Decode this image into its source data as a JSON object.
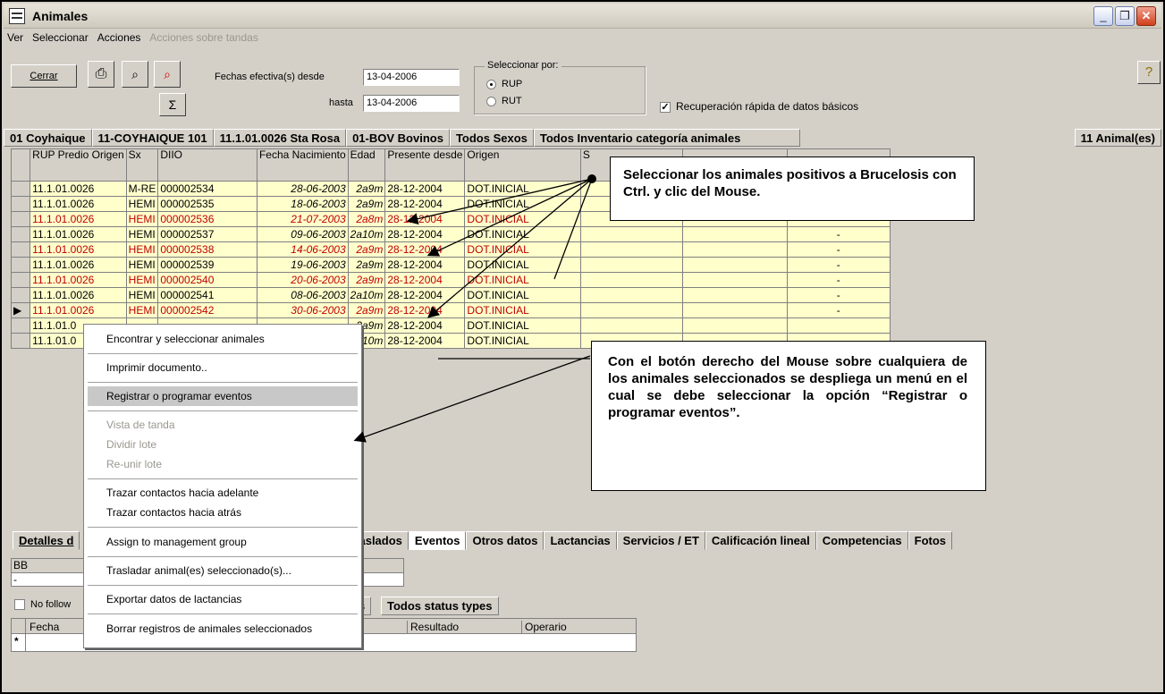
{
  "window": {
    "title": "Animales",
    "controls": [
      "minimize-icon",
      "restore-icon",
      "close-icon"
    ]
  },
  "menu": [
    "Ver",
    "Seleccionar",
    "Acciones"
  ],
  "menu_disabled": "Acciones sobre tandas",
  "toolbar": {
    "close_label": "Cerrar",
    "sigma": "Σ",
    "fechas_label": "Fechas efectiva(s) desde",
    "desde": "13-04-2006",
    "hasta_label": "hasta",
    "hasta": "13-04-2006",
    "seleccionar_por": "Seleccionar por:",
    "radio_rup": "RUP",
    "radio_rut": "RUT",
    "recuperacion": "Recuperación rápida de datos básicos"
  },
  "filters": [
    "01 Coyhaique",
    "11-COYHAIQUE 101",
    "11.1.01.0026 Sta Rosa",
    "01-BOV Bovinos",
    "Todos Sexos",
    "Todos Inventario categoría animales"
  ],
  "count": "11 Animal(es)",
  "grid": {
    "headers": [
      "RUP Predio Origen",
      "Sx",
      "DIIO",
      "Fecha Nacimiento",
      "Edad",
      "Presente desde",
      "Origen",
      "S"
    ],
    "rows": [
      {
        "rup": "11.1.01.0026",
        "sx": "M-RE",
        "diio": "000002534",
        "fecha": "28-06-2003",
        "edad": "2a9m",
        "presente": "28-12-2004",
        "origen": "DOT.INICIAL",
        "red": false
      },
      {
        "rup": "11.1.01.0026",
        "sx": "HEMI",
        "diio": "000002535",
        "fecha": "18-06-2003",
        "edad": "2a9m",
        "presente": "28-12-2004",
        "origen": "DOT.INICIAL",
        "red": false
      },
      {
        "rup": "11.1.01.0026",
        "sx": "HEMI",
        "diio": "000002536",
        "fecha": "21-07-2003",
        "edad": "2a8m",
        "presente": "28-12-2004",
        "origen": "DOT.INICIAL",
        "red": true
      },
      {
        "rup": "11.1.01.0026",
        "sx": "HEMI",
        "diio": "000002537",
        "fecha": "09-06-2003",
        "edad": "2a10m",
        "presente": "28-12-2004",
        "origen": "DOT.INICIAL",
        "red": false
      },
      {
        "rup": "11.1.01.0026",
        "sx": "HEMI",
        "diio": "000002538",
        "fecha": "14-06-2003",
        "edad": "2a9m",
        "presente": "28-12-2004",
        "origen": "DOT.INICIAL",
        "red": true
      },
      {
        "rup": "11.1.01.0026",
        "sx": "HEMI",
        "diio": "000002539",
        "fecha": "19-06-2003",
        "edad": "2a9m",
        "presente": "28-12-2004",
        "origen": "DOT.INICIAL",
        "red": false
      },
      {
        "rup": "11.1.01.0026",
        "sx": "HEMI",
        "diio": "000002540",
        "fecha": "20-06-2003",
        "edad": "2a9m",
        "presente": "28-12-2004",
        "origen": "DOT.INICIAL",
        "red": true
      },
      {
        "rup": "11.1.01.0026",
        "sx": "HEMI",
        "diio": "000002541",
        "fecha": "08-06-2003",
        "edad": "2a10m",
        "presente": "28-12-2004",
        "origen": "DOT.INICIAL",
        "red": false
      },
      {
        "rup": "11.1.01.0026",
        "sx": "HEMI",
        "diio": "000002542",
        "fecha": "30-06-2003",
        "edad": "2a9m",
        "presente": "28-12-2004",
        "origen": "DOT.INICIAL",
        "red": true
      },
      {
        "rup": "11.1.01.0",
        "sx": "",
        "diio": "",
        "fecha": "",
        "edad": "2a9m",
        "presente": "28-12-2004",
        "origen": "DOT.INICIAL",
        "red": false
      },
      {
        "rup": "11.1.01.0",
        "sx": "",
        "diio": "",
        "fecha": "",
        "edad": "2a10m",
        "presente": "28-12-2004",
        "origen": "DOT.INICIAL",
        "red": false
      }
    ],
    "dash": "-"
  },
  "callouts": {
    "top": "Seleccionar los animales positivos a Brucelosis con Ctrl. y clic del Mouse.",
    "bottom": "Con el botón derecho del Mouse sobre cualquiera de los animales seleccionados se despliega un menú en el cual se debe seleccionar la opción “Registrar o programar eventos”."
  },
  "context_menu": {
    "items": [
      {
        "label": "Encontrar y seleccionar animales",
        "disabled": false
      },
      {
        "label": "Imprimir documento..",
        "disabled": false
      },
      {
        "label": "Registrar o programar eventos",
        "disabled": false
      },
      {
        "label": "Vista de tanda",
        "disabled": true
      },
      {
        "label": "Dividir lote",
        "disabled": true
      },
      {
        "label": "Re-unir lote",
        "disabled": true
      },
      {
        "label": "Trazar contactos hacia adelante",
        "disabled": false
      },
      {
        "label": "Trazar contactos hacia atrás",
        "disabled": false
      },
      {
        "label": "Assign to management group",
        "disabled": false
      },
      {
        "label": "Trasladar animal(es) seleccionado(s)...",
        "disabled": false
      },
      {
        "label": "Exportar datos de lactancias",
        "disabled": false
      },
      {
        "label": "Borrar registros de animales seleccionados",
        "disabled": false
      }
    ]
  },
  "tabs": {
    "detalles": "Detalles d",
    "traslados": "raslados",
    "items": [
      "Eventos",
      "Otros datos",
      "Lactancias",
      "Servicios / ET",
      "Calificación lineal",
      "Competencias",
      "Fotos"
    ]
  },
  "lower": {
    "bb": "BB",
    "dash": "-",
    "no_follow": "No follow",
    "s_frag": "s",
    "status_types": "Todos status types",
    "cols": [
      "Fecha",
      "Resultado",
      "Operario"
    ],
    "new_row": "*"
  }
}
